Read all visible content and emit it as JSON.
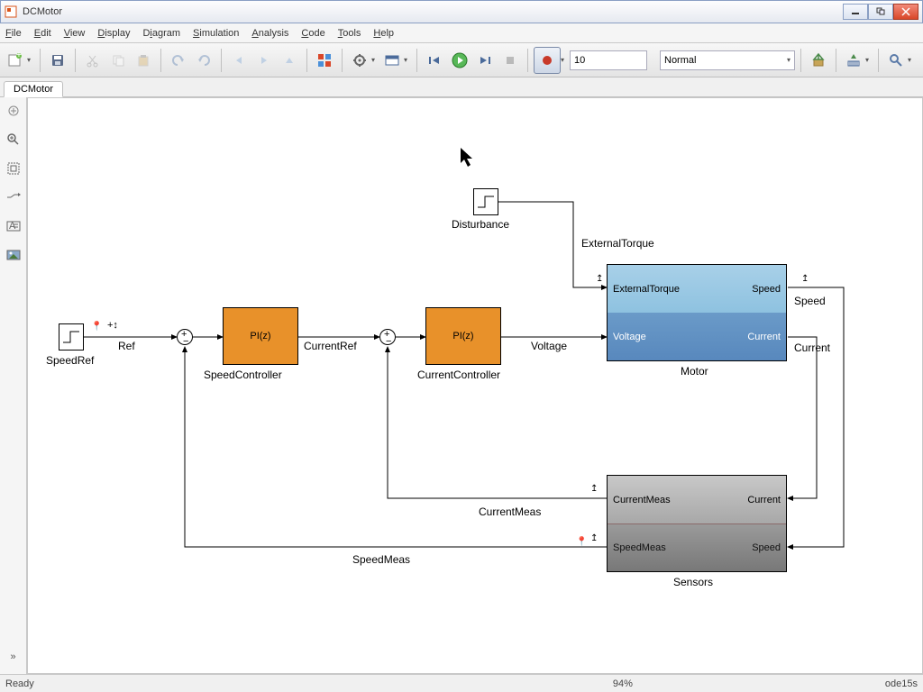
{
  "window": {
    "title": "DCMotor"
  },
  "menu": {
    "file": "File",
    "edit": "Edit",
    "view": "View",
    "display": "Display",
    "diagram": "Diagram",
    "simulation": "Simulation",
    "analysis": "Analysis",
    "code": "Code",
    "tools": "Tools",
    "help": "Help"
  },
  "toolbar": {
    "stop_time": "10",
    "mode": "Normal"
  },
  "tab": {
    "name": "DCMotor"
  },
  "blocks": {
    "speedref": {
      "label": "SpeedRef"
    },
    "disturbance": {
      "label": "Disturbance"
    },
    "speedctrl": {
      "text": "PI(z)",
      "label": "SpeedController"
    },
    "currentctrl": {
      "text": "PI(z)",
      "label": "CurrentController"
    },
    "motor": {
      "label": "Motor",
      "in1": "ExternalTorque",
      "in2": "Voltage",
      "out1": "Speed",
      "out2": "Current"
    },
    "sensors": {
      "label": "Sensors",
      "in1": "Current",
      "in2": "Speed",
      "out1": "CurrentMeas",
      "out2": "SpeedMeas"
    }
  },
  "signals": {
    "ref": "Ref",
    "currentref": "CurrentRef",
    "voltage": "Voltage",
    "externaltorque": "ExternalTorque",
    "speed": "Speed",
    "current": "Current",
    "currentmeas": "CurrentMeas",
    "speedmeas": "SpeedMeas"
  },
  "status": {
    "ready": "Ready",
    "zoom": "94%",
    "solver": "ode15s"
  }
}
